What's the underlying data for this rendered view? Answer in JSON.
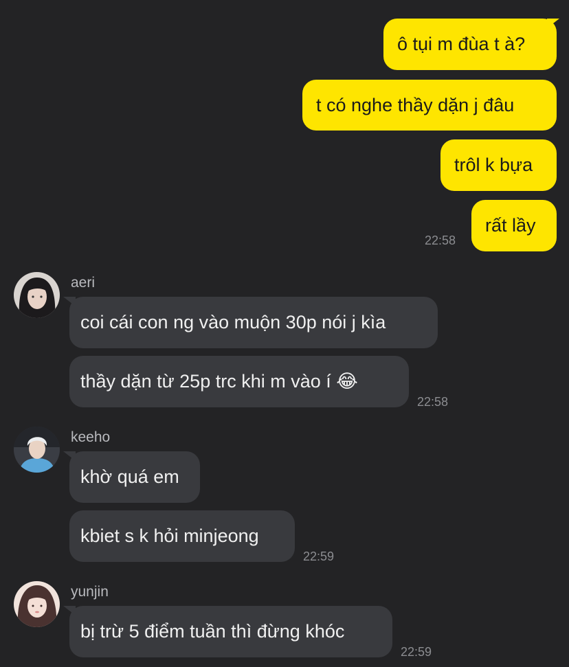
{
  "outgoing": {
    "messages": [
      "ô tụi m đùa t à?",
      "t có nghe thầy dặn j đâu",
      "trôl k bựa",
      "rất lầy"
    ],
    "time": "22:58"
  },
  "groups": [
    {
      "sender": "aeri",
      "avatar_icon": "aeri-avatar-photo",
      "messages": [
        "coi cái con ng vào muộn 30p nói j kìa",
        "thầy dặn từ 25p trc khi m vào í 😂"
      ],
      "time": "22:58"
    },
    {
      "sender": "keeho",
      "avatar_icon": "keeho-avatar-photo",
      "messages": [
        "khờ quá em",
        "kbiet s k hỏi minjeong"
      ],
      "time": "22:59"
    },
    {
      "sender": "yunjin",
      "avatar_icon": "yunjin-avatar-photo",
      "messages": [
        "bị trừ 5 điểm tuần thì đừng khóc"
      ],
      "time": "22:59"
    }
  ],
  "colors": {
    "background": "#232325",
    "outgoing_bubble": "#FEE500",
    "incoming_bubble": "#393a3e"
  }
}
